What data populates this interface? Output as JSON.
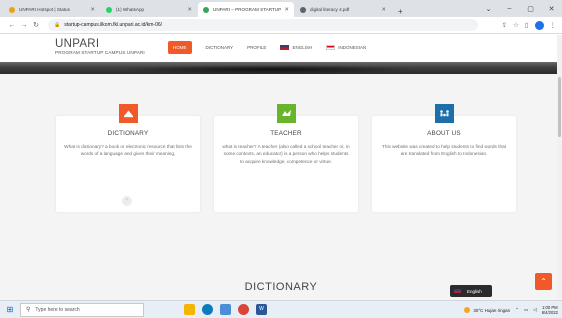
{
  "browser": {
    "tabs": [
      {
        "title": "UNPARI Hotspot | Status",
        "favicon_color": "#e8a317",
        "active": false
      },
      {
        "title": "(1) WhatsApp",
        "favicon_color": "#25d366",
        "active": false
      },
      {
        "title": "UNPARI – PROGRAM STARTUP C",
        "favicon_color": "#34a853",
        "active": true
      },
      {
        "title": "digital literacy 4.pdf",
        "favicon_color": "#5f6368",
        "active": false
      }
    ],
    "new_tab": "+",
    "window_controls": [
      "⌄",
      "–",
      "▢",
      "✕"
    ],
    "url": "startup-campus.ilkom.fkl.unpari.ac.id/km-06/"
  },
  "site": {
    "brand_name": "UNPARI",
    "brand_sub": "PROGRAM STARTUP CAMPUS UNPARI",
    "nav": {
      "home": "HOME",
      "dictionary": "DICTIONARY",
      "profile": "PROFILE",
      "english": "ENGLISH",
      "indonesian": "INDONESIAN"
    }
  },
  "cards": [
    {
      "title": "DICTIONARY",
      "icon": "book-icon",
      "icon_color": "#f05a28",
      "desc": "What is dictionary? a book or electronic resource that lists the words of a language and gives their meaning,"
    },
    {
      "title": "TEACHER",
      "icon": "teacher-icon",
      "icon_color": "#6ab42d",
      "desc": "what is teacher? A teacher (also called a school teacher or, in some contexts, an educator) is a person who helps students to acquire knowledge, competence or virtue."
    },
    {
      "title": "ABOUT US",
      "icon": "people-icon",
      "icon_color": "#1c6fa8",
      "desc": "This website was created to help students to find words that are translated from English to Indonesian."
    }
  ],
  "section_title": "DICTIONARY",
  "language_button": "English",
  "taskbar": {
    "search_placeholder": "Type here to search",
    "weather": "30°C  Hujan ringan",
    "time": "1:00 PM",
    "date": "6/4/2022"
  }
}
